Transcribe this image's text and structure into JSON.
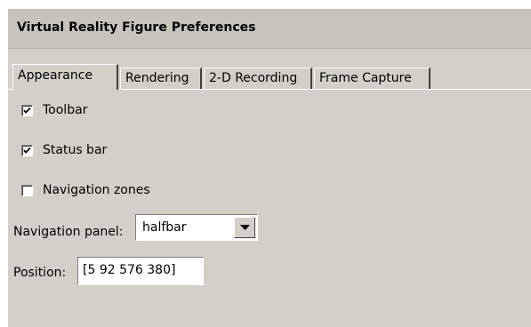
{
  "dialog": {
    "title": "Virtual Reality Figure Preferences"
  },
  "tabs": [
    {
      "label": "Appearance",
      "active": true
    },
    {
      "label": "Rendering",
      "active": false
    },
    {
      "label": "2-D Recording",
      "active": false
    },
    {
      "label": "Frame Capture",
      "active": false
    }
  ],
  "appearance": {
    "toolbar": {
      "label": "Toolbar",
      "checked": true
    },
    "status_bar": {
      "label": "Status bar",
      "checked": true
    },
    "navigation_zones": {
      "label": "Navigation zones",
      "checked": false
    },
    "navigation_panel": {
      "label": "Navigation panel:",
      "value": "halfbar"
    },
    "position": {
      "label": "Position:",
      "value": "[5 92 576 380]"
    }
  },
  "colors": {
    "panel_bg": "#d4d0c8",
    "title_bg": "#c8c4bc"
  }
}
